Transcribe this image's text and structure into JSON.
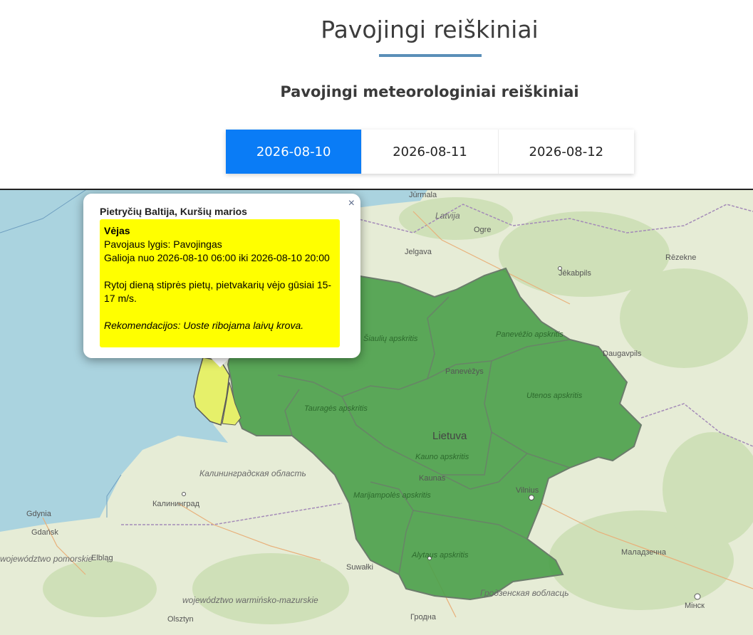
{
  "header": {
    "title": "Pavojingi reiškiniai",
    "subtitle": "Pavojingi meteorologiniai reiškiniai"
  },
  "tabs": [
    {
      "label": "2026-08-10",
      "active": true
    },
    {
      "label": "2026-08-11",
      "active": false
    },
    {
      "label": "2026-08-12",
      "active": false
    }
  ],
  "colors": {
    "accent": "#0a7cf6",
    "warning_yellow": "#ffff00",
    "region_green": "#4aa04a",
    "sea": "#aad3df",
    "land": "#e8eedb"
  },
  "popup": {
    "close_symbol": "×",
    "region": "Pietryčių Baltija, Kuršių marios",
    "phenomenon": "Vėjas",
    "level": "Pavojaus lygis: Pavojingas",
    "validity": "Galioja nuo 2026-08-10 06:00 iki 2026-08-10 20:00",
    "description": "Rytoj dieną stiprės pietų, pietvakarių vėjo gūsiai 15-17 m/s.",
    "recommendation": "Rekomendacijos: Uoste ribojama laivų krova."
  },
  "map": {
    "country_label": "Lietuva",
    "cities": [
      "Jūrmala",
      "Ogre",
      "Jelgava",
      "Jēkabpils",
      "Rēzekne",
      "Daugavpils",
      "Panevėžys",
      "Kaunas",
      "Vilnius",
      "Калининград",
      "Gdynia",
      "Gdańsk",
      "Elbląg",
      "Olsztyn",
      "Suwałki",
      "Гродна",
      "Мінск",
      "Маладзечна"
    ],
    "regions": [
      "Šiaulių apskritis",
      "Panevėžio apskritis",
      "Utenos apskritis",
      "Tauragės apskritis",
      "Kauno apskritis",
      "Marijampolės apskritis",
      "Alytaus apskritis"
    ],
    "areas": [
      "Latvija",
      "Калининградская область",
      "Гродзенская вобласць",
      "województwo warmińsko-mazurskie",
      "województwo pomorskie"
    ]
  }
}
